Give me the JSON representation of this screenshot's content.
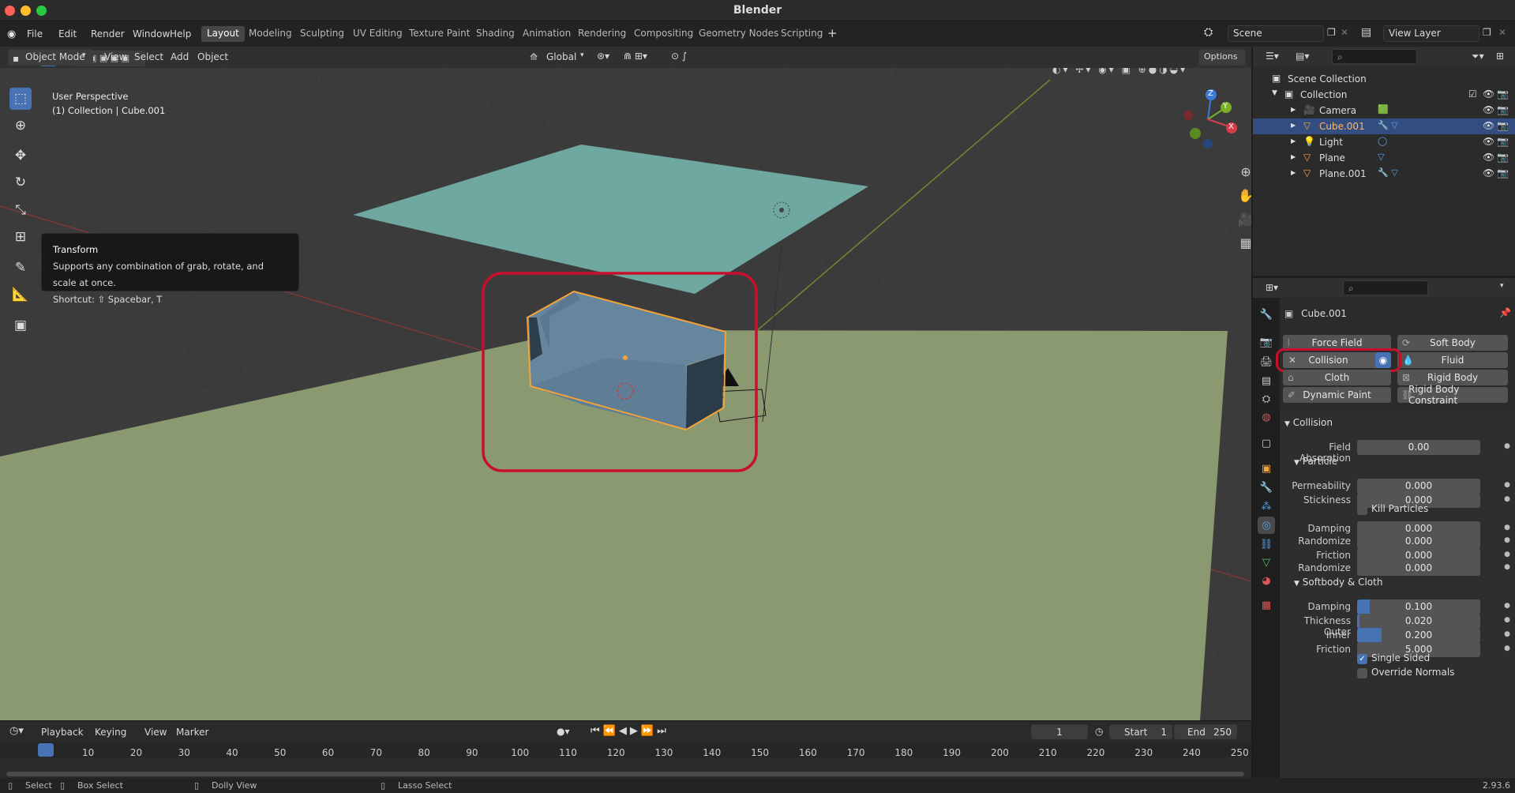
{
  "window": {
    "title": "Blender"
  },
  "menu": {
    "items": [
      "File",
      "Edit",
      "Render",
      "Window",
      "Help"
    ]
  },
  "workspaces": [
    "Layout",
    "Modeling",
    "Sculpting",
    "UV Editing",
    "Texture Paint",
    "Shading",
    "Animation",
    "Rendering",
    "Compositing",
    "Geometry Nodes",
    "Scripting"
  ],
  "active_workspace": "Layout",
  "scene": {
    "name": "Scene",
    "view_layer": "View Layer"
  },
  "header3d": {
    "mode": "Object Mode",
    "menus": [
      "View",
      "Select",
      "Add",
      "Object"
    ],
    "orientation": "Global",
    "options": "Options"
  },
  "viewport": {
    "perspective": "User Perspective",
    "context": "(1) Collection | Cube.001",
    "colors": {
      "ground": "#9aa877",
      "plane_top": "#7fb1a8",
      "cube": "#66869e",
      "highlight": "#c8102e",
      "selection": "#f2a33a"
    }
  },
  "tooltip": {
    "title": "Transform",
    "desc": "Supports any combination of grab, rotate, and scale at once.",
    "shortcut": "Shortcut: ⇧ Spacebar, T"
  },
  "gizmo": {
    "x": "X",
    "y": "Y",
    "z": "Z"
  },
  "outliner": {
    "root": "Scene Collection",
    "collection": "Collection",
    "items": [
      {
        "name": "Camera",
        "icon": "camera-icon"
      },
      {
        "name": "Cube.001",
        "icon": "mesh-icon",
        "selected": true
      },
      {
        "name": "Light",
        "icon": "light-icon"
      },
      {
        "name": "Plane",
        "icon": "mesh-icon"
      },
      {
        "name": "Plane.001",
        "icon": "mesh-icon"
      }
    ]
  },
  "properties": {
    "object": "Cube.001",
    "physics_buttons": {
      "force_field": "Force Field",
      "soft_body": "Soft Body",
      "collision": "Collision",
      "fluid": "Fluid",
      "cloth": "Cloth",
      "rigid_body": "Rigid Body",
      "dynamic_paint": "Dynamic Paint",
      "rigid_body_constraint": "Rigid Body Constraint"
    },
    "collision_header": "Collision",
    "field_absorption": {
      "label": "Field Absorption",
      "value": "0.00"
    },
    "particle_header": "Particle",
    "permeability": {
      "label": "Permeability",
      "value": "0.000"
    },
    "stickiness": {
      "label": "Stickiness",
      "value": "0.000"
    },
    "kill_particles": "Kill Particles",
    "p_damping": {
      "label": "Damping",
      "value": "0.000"
    },
    "p_randomize": {
      "label": "Randomize",
      "value": "0.000"
    },
    "p_friction": {
      "label": "Friction",
      "value": "0.000"
    },
    "p_randomize2": {
      "label": "Randomize",
      "value": "0.000"
    },
    "softbody_header": "Softbody & Cloth",
    "s_damping": {
      "label": "Damping",
      "value": "0.100",
      "fraction": 0.1
    },
    "thickness_outer": {
      "label": "Thickness Outer",
      "value": "0.020",
      "fraction": 0.02
    },
    "inner": {
      "label": "Inner",
      "value": "0.200",
      "fraction": 0.2
    },
    "s_friction": {
      "label": "Friction",
      "value": "5.000"
    },
    "single_sided": "Single Sided",
    "override_normals": "Override Normals"
  },
  "timeline": {
    "menus": [
      "Playback",
      "Keying",
      "View",
      "Marker"
    ],
    "current_frame": "1",
    "start_label": "Start",
    "start": "1",
    "end_label": "End",
    "end": "250",
    "ticks": [
      "1",
      "10",
      "20",
      "30",
      "40",
      "50",
      "60",
      "70",
      "80",
      "90",
      "100",
      "110",
      "120",
      "130",
      "140",
      "150",
      "160",
      "170",
      "180",
      "190",
      "200",
      "210",
      "220",
      "230",
      "240",
      "250"
    ]
  },
  "status": {
    "select": "Select",
    "box_select": "Box Select",
    "dolly": "Dolly View",
    "lasso": "Lasso Select",
    "version": "2.93.6"
  }
}
